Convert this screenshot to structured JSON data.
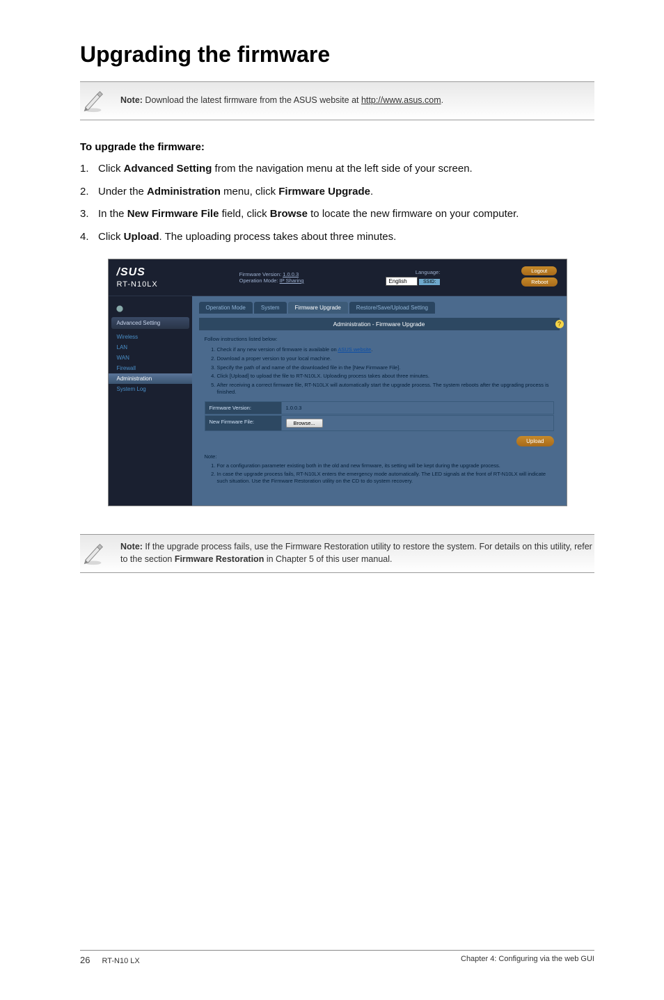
{
  "heading": "Upgrading the firmware",
  "note1": {
    "label": "Note:",
    "text": " Download the latest firmware from the ASUS website at ",
    "link": "http://www.asus.com",
    "suffix": "."
  },
  "sub_heading": "To upgrade the firmware:",
  "steps": [
    {
      "num": "1.",
      "pre": "Click ",
      "b1": "Advanced Setting",
      "mid": " from the navigation menu at the left side of your screen."
    },
    {
      "num": "2.",
      "pre": "Under the ",
      "b1": "Administration",
      "mid": " menu, click ",
      "b2": "Firmware Upgrade",
      "suf": "."
    },
    {
      "num": "3.",
      "pre": "In the ",
      "b1": "New Firmware File",
      "mid": " field, click ",
      "b2": "Browse",
      "suf": " to locate the new firmware on your computer."
    },
    {
      "num": "4.",
      "pre": "Click ",
      "b1": "Upload",
      "mid": ". The uploading process takes about three minutes."
    }
  ],
  "router": {
    "brand": "/SUS",
    "model": "RT-N10LX",
    "fw_version_label": "Firmware Version:",
    "fw_version_link": "1.0.0.3",
    "op_mode_label": "Operation Mode:",
    "op_mode_link": "IP Sharing",
    "language_label": "Language:",
    "language_value": "English",
    "logout_btn": "Logout",
    "reboot_btn": "Reboot",
    "ssid_label": "SSID:",
    "sidebar_adv": "Advanced Setting",
    "sidebar_items": [
      "Wireless",
      "LAN",
      "WAN",
      "Firewall",
      "Administration",
      "System Log"
    ],
    "tabs": [
      "Operation Mode",
      "System",
      "Firmware Upgrade",
      "Restore/Save/Upload Setting"
    ],
    "panel_heading": "Administration - Firmware Upgrade",
    "intro": "Follow instructions listed below:",
    "instructions": [
      {
        "pre": "Check if any new version of firmware is available on ",
        "link": "ASUS website",
        "suf": "."
      },
      {
        "pre": "Download a proper version to your local machine."
      },
      {
        "pre": "Specify the path of and name of the downloaded file in the [New Firmware File]."
      },
      {
        "pre": "Click [Upload] to upload the file to RT-N10LX. Uploading process takes about three minutes."
      },
      {
        "pre": "After receiving a correct firmware file, RT-N10LX will automatically start the upgrade process. The system reboots after the upgrading process is finished."
      }
    ],
    "form": {
      "fw_label": "Firmware Version:",
      "fw_value": "1.0.0.3",
      "new_file_label": "New Firmware File:",
      "browse": "Browse...",
      "upload": "Upload"
    },
    "note_label": "Note:",
    "notes": [
      "For a configuration parameter existing both in the old and new firmware, its setting will be kept during the upgrade process.",
      "In case the upgrade process fails, RT-N10LX enters the emergency mode automatically. The LED signals at the front of RT-N10LX will indicate such situation. Use the Firmware Restoration utility on the CD to do system recovery."
    ]
  },
  "note2": {
    "label": "Note:",
    "text": " If the upgrade process fails, use the Firmware Restoration utility to restore the system. For details on this utility, refer to the section ",
    "bold": "Firmware Restoration",
    "suffix": " in Chapter 5 of this user manual."
  },
  "footer": {
    "page": "26",
    "left": "RT-N10 LX",
    "right": "Chapter 4: Configuring via the web GUI"
  }
}
